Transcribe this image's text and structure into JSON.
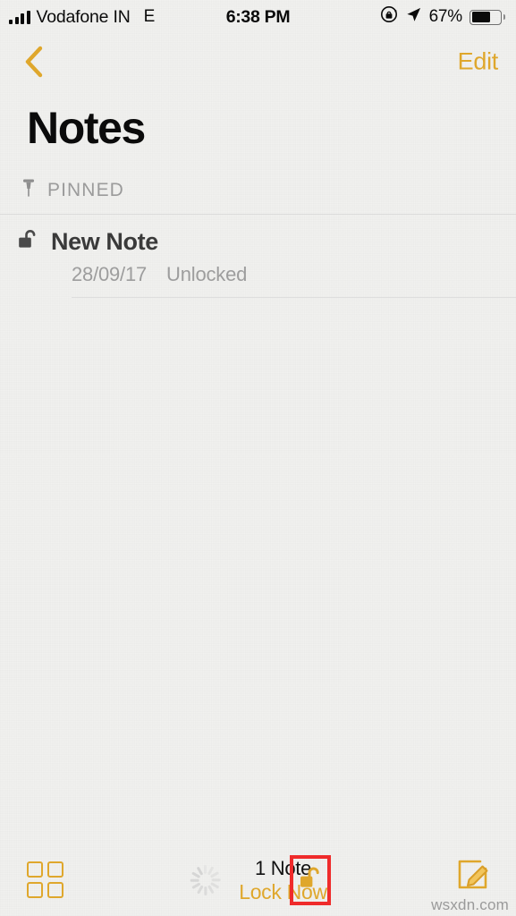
{
  "status_bar": {
    "carrier": "Vodafone IN",
    "network_type": "E",
    "time": "6:38 PM",
    "battery_percent": "67%",
    "battery_level": 67,
    "signal_bars": 4,
    "icons": [
      "signal-bars-icon",
      "rotation-lock-icon",
      "location-arrow-icon",
      "battery-icon"
    ]
  },
  "nav_bar": {
    "back_label": "back-chevron",
    "edit_label": "Edit"
  },
  "page": {
    "title": "Notes"
  },
  "sections": {
    "pinned": {
      "label": "PINNED",
      "icon": "pin-icon"
    }
  },
  "notes": [
    {
      "title": "New Note",
      "date": "28/09/17",
      "state": "Unlocked",
      "lock_icon": "unlocked-padlock-icon"
    }
  ],
  "toolbar": {
    "grid_icon": "grid-view-icon",
    "spinner": "activity-spinner-icon",
    "count_text": "1 Note",
    "lock_now_label": "Lock Now",
    "lock_button_icon": "unlocked-padlock-icon",
    "compose_icon": "compose-note-icon"
  },
  "annotation": {
    "highlight_color": "#ef2b2b",
    "target": "lock-toolbar-button"
  },
  "watermark": {
    "text": "wsxdn.com"
  },
  "colors": {
    "accent_gold": "#dfa72c",
    "background": "#f1f1ef",
    "title_text": "#0b0b0b",
    "secondary_text": "#9d9d9d"
  }
}
